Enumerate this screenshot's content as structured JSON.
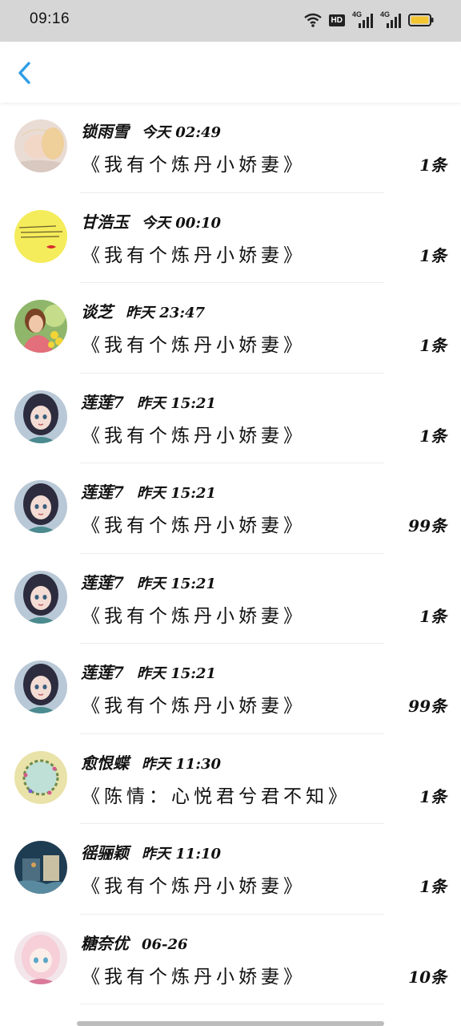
{
  "status": {
    "time": "09:16",
    "hd": "HD",
    "net1": "4G",
    "net2": "4G"
  },
  "rows": [
    {
      "name": "锁雨雪",
      "time": "今天 02:49",
      "book": "《我有个炼丹小娇妻》",
      "count": "1条",
      "avatar": "woman-lying-avatar"
    },
    {
      "name": "甘浩玉",
      "time": "今天 00:10",
      "book": "《我有个炼丹小娇妻》",
      "count": "1条",
      "avatar": "yellow-note-avatar"
    },
    {
      "name": "谈芝",
      "time": "昨天 23:47",
      "book": "《我有个炼丹小娇妻》",
      "count": "1条",
      "avatar": "girl-flowers-avatar"
    },
    {
      "name": "莲莲7",
      "time": "昨天 15:21",
      "book": "《我有个炼丹小娇妻》",
      "count": "1条",
      "avatar": "anime-girl-avatar"
    },
    {
      "name": "莲莲7",
      "time": "昨天 15:21",
      "book": "《我有个炼丹小娇妻》",
      "count": "99条",
      "avatar": "anime-girl-avatar"
    },
    {
      "name": "莲莲7",
      "time": "昨天 15:21",
      "book": "《我有个炼丹小娇妻》",
      "count": "1条",
      "avatar": "anime-girl-avatar"
    },
    {
      "name": "莲莲7",
      "time": "昨天 15:21",
      "book": "《我有个炼丹小娇妻》",
      "count": "99条",
      "avatar": "anime-girl-avatar"
    },
    {
      "name": "愈恨蝶",
      "time": "昨天 11:30",
      "book": "《陈情：心悦君兮君不知》",
      "count": "1条",
      "avatar": "wreath-avatar"
    },
    {
      "name": "徭骊颖",
      "time": "昨天 11:10",
      "book": "《我有个炼丹小娇妻》",
      "count": "1条",
      "avatar": "blue-photo-avatar"
    },
    {
      "name": "糖奈优",
      "time": "06-26",
      "book": "《我有个炼丹小娇妻》",
      "count": "10条",
      "avatar": "anime-pink-avatar"
    }
  ]
}
